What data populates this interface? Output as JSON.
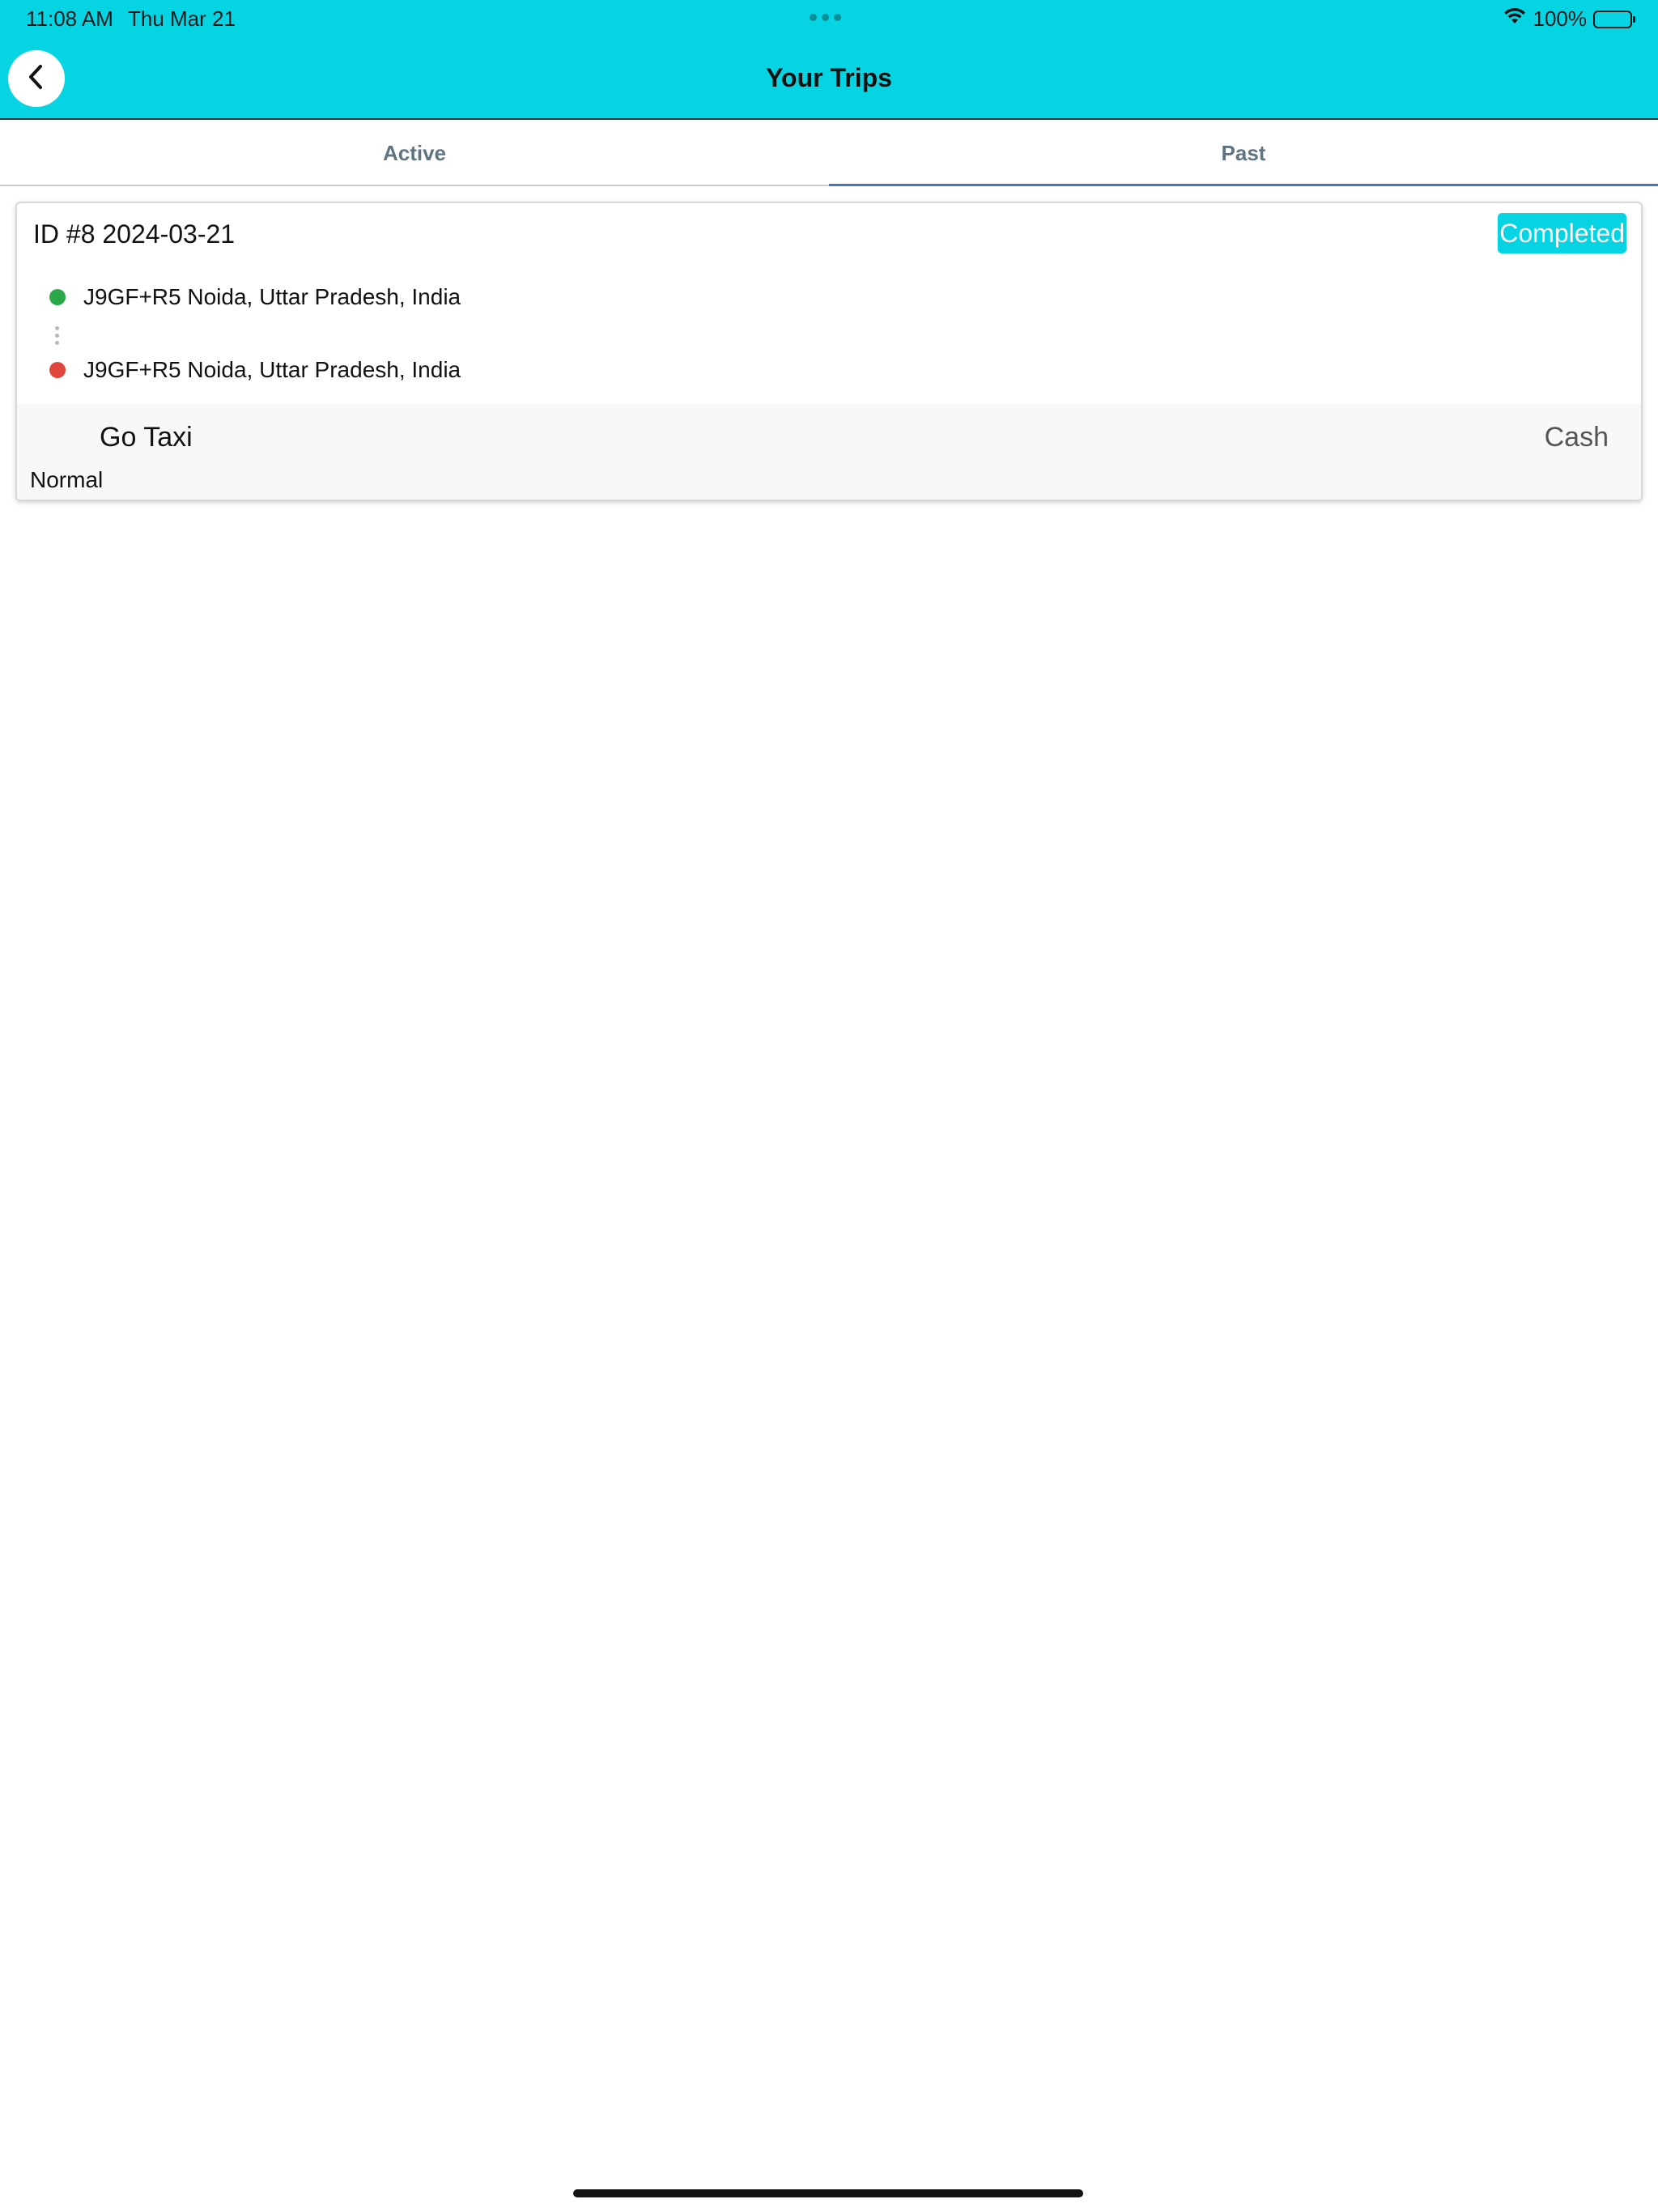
{
  "status_bar": {
    "time": "11:08 AM",
    "date": "Thu Mar 21",
    "battery": "100%",
    "icons": [
      "wifi-icon",
      "battery-icon"
    ]
  },
  "header": {
    "title": "Your Trips",
    "back_icon": "chevron-left-icon"
  },
  "tabs": [
    {
      "label": "Active",
      "selected": false
    },
    {
      "label": "Past",
      "selected": true
    }
  ],
  "trips": [
    {
      "id_date": "ID #8 2024-03-21",
      "status": "Completed",
      "pickup": "J9GF+R5 Noida, Uttar Pradesh, India",
      "dropoff": "J9GF+R5 Noida, Uttar Pradesh, India",
      "vehicle": "Go Taxi",
      "payment": "Cash",
      "ride_type": "Normal"
    }
  ],
  "colors": {
    "header_bg": "#06d4e3",
    "badge_bg": "#06d4e3",
    "pickup_dot": "#2aa84a",
    "dropoff_dot": "#e0463b",
    "tab_indicator": "#4a73c5"
  }
}
